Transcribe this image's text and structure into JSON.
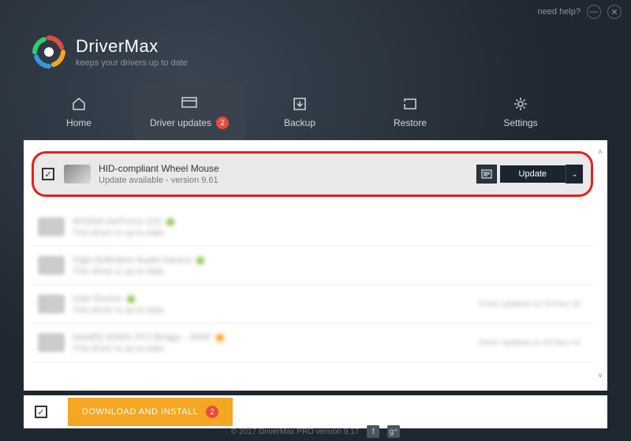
{
  "titlebar": {
    "help": "need help?"
  },
  "brand": {
    "name": "DriverMax",
    "tagline": "keeps your drivers up to date"
  },
  "tabs": {
    "home": "Home",
    "updates": "Driver updates",
    "updates_badge": "2",
    "backup": "Backup",
    "restore": "Restore",
    "settings": "Settings"
  },
  "drivers": {
    "featured": {
      "name": "HID-compliant Wheel Mouse",
      "sub": "Update available - version 9.61",
      "update_btn": "Update"
    },
    "rows": [
      {
        "name": "NVIDIA GeForce 210",
        "sub": "This driver is up-to-date",
        "dot": "g"
      },
      {
        "name": "High Definition Audio Device",
        "sub": "This driver is up-to-date",
        "dot": "g"
      },
      {
        "name": "Intel Device",
        "sub": "This driver is up-to-date",
        "dot": "g",
        "right": "Driver updated on 03-Nov-16"
      },
      {
        "name": "Intel(R) 82801 PCI Bridge - 244E",
        "sub": "This driver is up-to-date",
        "dot": "o",
        "right": "Driver updated on 03-Nov-16"
      }
    ]
  },
  "bottom": {
    "install": "DOWNLOAD AND INSTALL",
    "install_badge": "2"
  },
  "footer": {
    "copyright": "© 2017 DriverMax PRO version 9.17"
  }
}
